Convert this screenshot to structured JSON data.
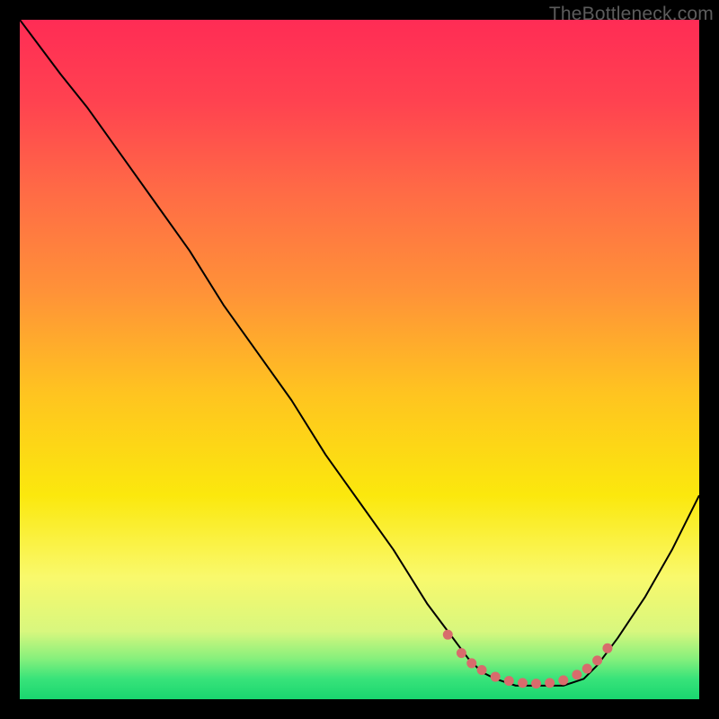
{
  "watermark": "TheBottleneck.com",
  "chart_data": {
    "type": "line",
    "title": "",
    "xlabel": "",
    "ylabel": "",
    "xlim": [
      0,
      100
    ],
    "ylim": [
      0,
      100
    ],
    "grid": false,
    "background_gradient": {
      "stops": [
        {
          "offset": 0.0,
          "color": "#ff2c55"
        },
        {
          "offset": 0.12,
          "color": "#ff4250"
        },
        {
          "offset": 0.25,
          "color": "#ff6a46"
        },
        {
          "offset": 0.4,
          "color": "#ff9238"
        },
        {
          "offset": 0.55,
          "color": "#ffc420"
        },
        {
          "offset": 0.7,
          "color": "#fbe80d"
        },
        {
          "offset": 0.82,
          "color": "#f9f96c"
        },
        {
          "offset": 0.9,
          "color": "#d8f77e"
        },
        {
          "offset": 0.94,
          "color": "#87f07c"
        },
        {
          "offset": 0.97,
          "color": "#38e37a"
        },
        {
          "offset": 1.0,
          "color": "#19d66f"
        }
      ]
    },
    "series": [
      {
        "name": "bottleneck-curve",
        "color": "#000000",
        "stroke_width": 2,
        "x": [
          0,
          3,
          6,
          10,
          15,
          20,
          25,
          30,
          35,
          40,
          45,
          50,
          55,
          60,
          63,
          66,
          68,
          70,
          73,
          76,
          80,
          83,
          85,
          88,
          92,
          96,
          100
        ],
        "y": [
          100,
          96,
          92,
          87,
          80,
          73,
          66,
          58,
          51,
          44,
          36,
          29,
          22,
          14,
          10,
          6,
          4,
          3,
          2,
          2,
          2,
          3,
          5,
          9,
          15,
          22,
          30
        ]
      }
    ],
    "markers": {
      "name": "highlight-dots",
      "color": "#d86c6c",
      "radius": 5.5,
      "x": [
        63,
        65,
        66.5,
        68,
        70,
        72,
        74,
        76,
        78,
        80,
        82,
        83.5,
        85,
        86.5
      ],
      "y": [
        9.5,
        6.8,
        5.3,
        4.3,
        3.3,
        2.7,
        2.4,
        2.3,
        2.4,
        2.8,
        3.6,
        4.5,
        5.7,
        7.5
      ]
    }
  }
}
